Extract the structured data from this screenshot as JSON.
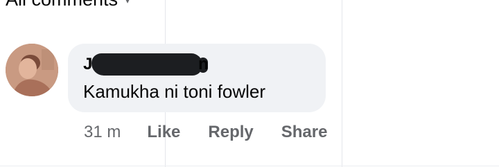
{
  "header": {
    "title": "All comments",
    "chevron_icon": "chevron-down-icon"
  },
  "comment": {
    "author_initial": "J",
    "author_trailing": "n",
    "author_redacted": true,
    "text": "Kamukha ni toni fowler",
    "time": "31 m",
    "actions": {
      "like": "Like",
      "reply": "Reply",
      "share": "Share"
    }
  }
}
